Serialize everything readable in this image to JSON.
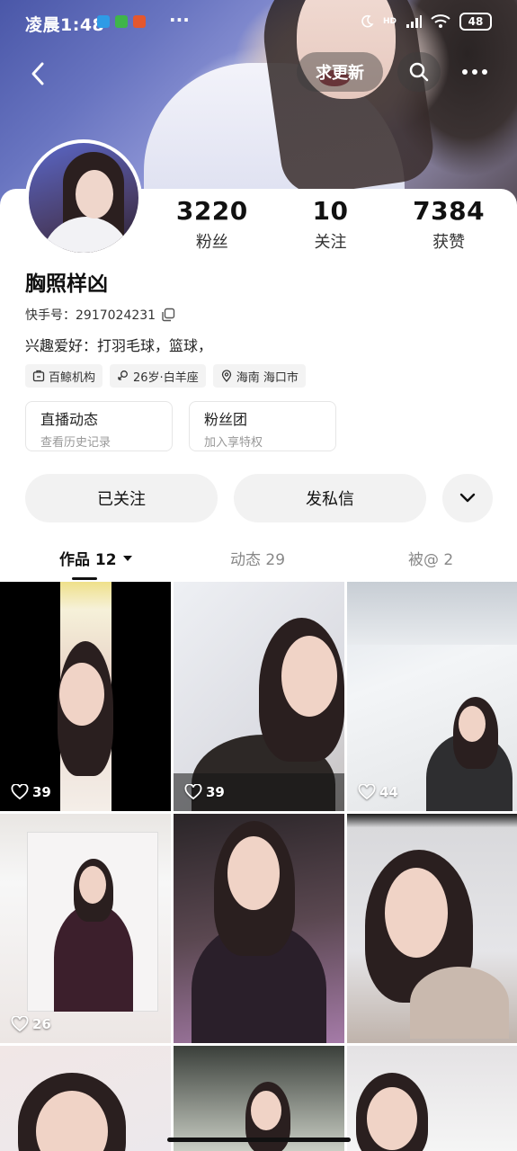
{
  "status_bar": {
    "time": "凌晨1:48",
    "more": "···",
    "battery": "48",
    "network": "HD"
  },
  "top_bar": {
    "update_button": "求更新"
  },
  "profile": {
    "name": "胸照样凶",
    "uid_label": "快手号：2917024231",
    "bio": "兴趣爱好：打羽毛球，篮球，",
    "tags": [
      {
        "icon": "organization-icon",
        "label": "百鲸机构"
      },
      {
        "icon": "gender-female-icon",
        "label": "26岁·白羊座"
      },
      {
        "icon": "location-pin-icon",
        "label": "海南 海口市"
      }
    ]
  },
  "stats": [
    {
      "value": "3220",
      "label": "粉丝"
    },
    {
      "value": "10",
      "label": "关注"
    },
    {
      "value": "7384",
      "label": "获赞"
    }
  ],
  "features": [
    {
      "title": "直播动态",
      "subtitle": "查看历史记录"
    },
    {
      "title": "粉丝团",
      "subtitle": "加入享特权"
    }
  ],
  "actions": {
    "followed": "已关注",
    "message": "发私信"
  },
  "tabs": [
    {
      "label": "作品 12",
      "active": true
    },
    {
      "label": "动态 29",
      "active": false
    },
    {
      "label": "被@ 2",
      "active": false
    }
  ],
  "grid": [
    {
      "likes": "39"
    },
    {
      "likes": "39"
    },
    {
      "likes": "44"
    },
    {
      "likes": "26"
    },
    {
      "likes": ""
    },
    {
      "likes": ""
    },
    {
      "likes": ""
    },
    {
      "likes": ""
    },
    {
      "likes": ""
    }
  ],
  "colors": {
    "button_bg": "#f2f2f2",
    "tag_bg": "#f3f3f3",
    "text_primary": "#111111",
    "text_secondary": "#999999"
  }
}
